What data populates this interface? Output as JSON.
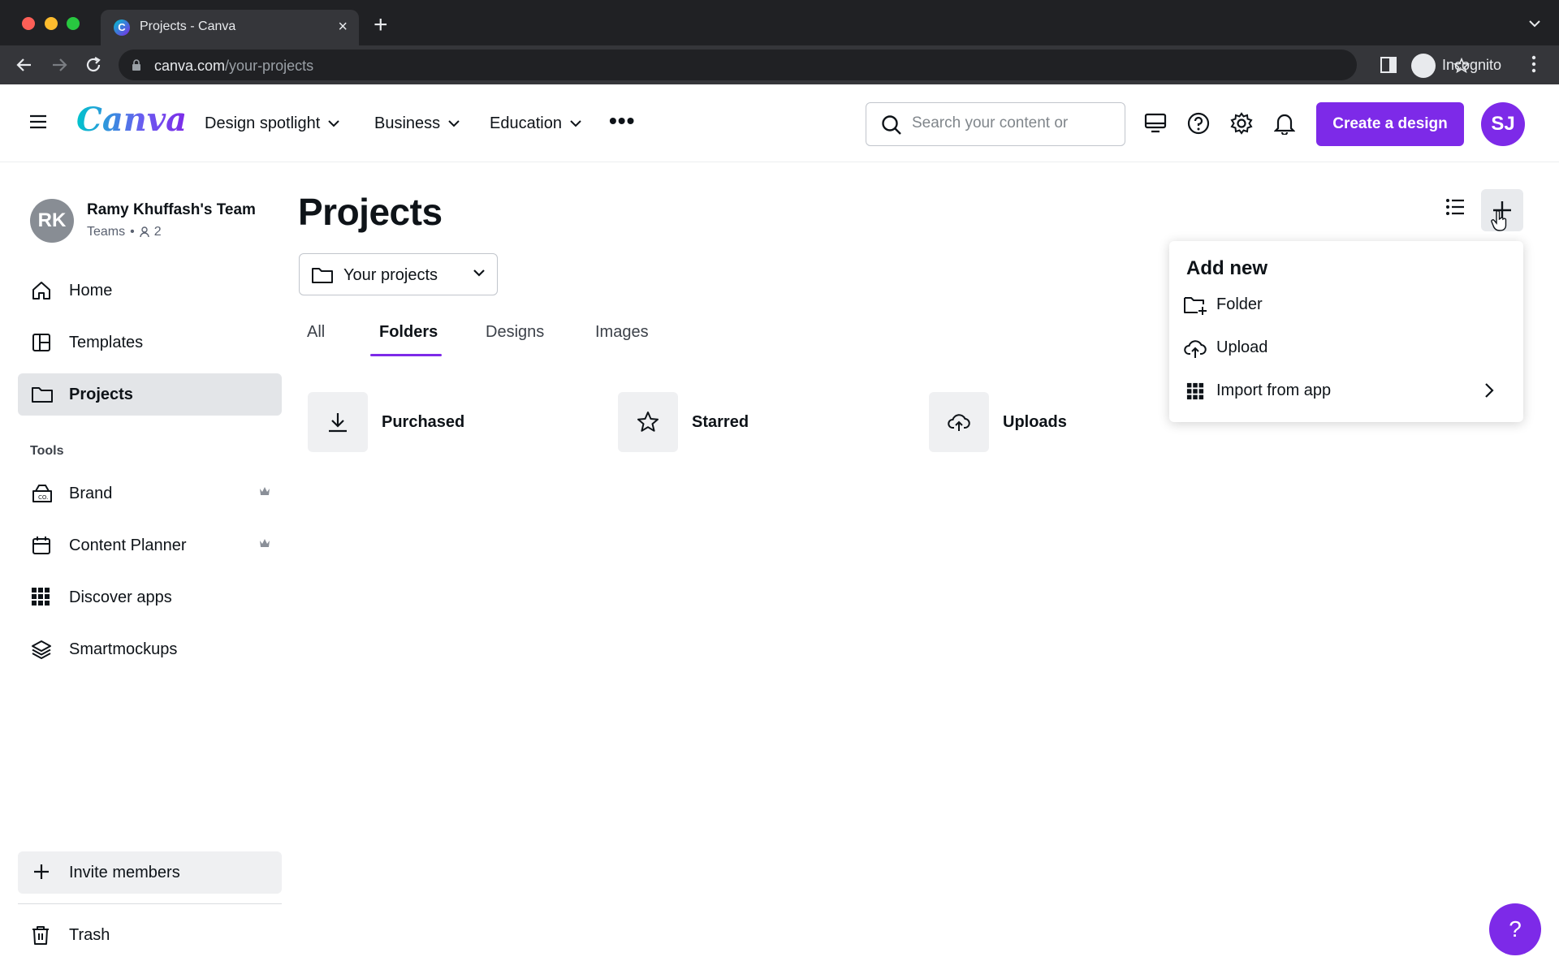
{
  "browser": {
    "tab_title": "Projects - Canva",
    "favicon_letter": "C",
    "url_host": "canva.com",
    "url_path": "/your-projects",
    "profile_label": "Incognito"
  },
  "header": {
    "logo": "Canva",
    "nav": [
      {
        "label": "Design spotlight"
      },
      {
        "label": "Business"
      },
      {
        "label": "Education"
      }
    ],
    "search_placeholder": "Search your content or",
    "create_label": "Create a design",
    "user_initials": "SJ"
  },
  "sidebar": {
    "team": {
      "initials": "RK",
      "name": "Ramy Khuffash's Team",
      "plan": "Teams",
      "members": "2"
    },
    "items": [
      {
        "label": "Home",
        "icon": "home-icon"
      },
      {
        "label": "Templates",
        "icon": "templates-icon"
      },
      {
        "label": "Projects",
        "icon": "folder-icon",
        "active": true
      }
    ],
    "tools_heading": "Tools",
    "tools": [
      {
        "label": "Brand",
        "icon": "brand-icon",
        "premium": true
      },
      {
        "label": "Content Planner",
        "icon": "calendar-icon",
        "premium": true
      },
      {
        "label": "Discover apps",
        "icon": "apps-grid-icon"
      },
      {
        "label": "Smartmockups",
        "icon": "layers-icon"
      }
    ],
    "invite_label": "Invite members",
    "trash_label": "Trash"
  },
  "main": {
    "title": "Projects",
    "scope_select": "Your projects",
    "tabs": [
      {
        "label": "All"
      },
      {
        "label": "Folders",
        "active": true
      },
      {
        "label": "Designs"
      },
      {
        "label": "Images"
      }
    ],
    "folders": [
      {
        "label": "Purchased",
        "icon": "download-icon"
      },
      {
        "label": "Starred",
        "icon": "star-icon"
      },
      {
        "label": "Uploads",
        "icon": "cloud-upload-icon"
      }
    ]
  },
  "add_menu": {
    "title": "Add new",
    "items": [
      {
        "label": "Folder",
        "icon": "folder-plus-icon"
      },
      {
        "label": "Upload",
        "icon": "cloud-upload-icon"
      },
      {
        "label": "Import from app",
        "icon": "apps-grid-icon",
        "submenu": true
      }
    ]
  },
  "help_label": "?",
  "colors": {
    "accent": "#7d2ae8",
    "chrome_dark": "#202124",
    "chrome_bar": "#35363a"
  }
}
